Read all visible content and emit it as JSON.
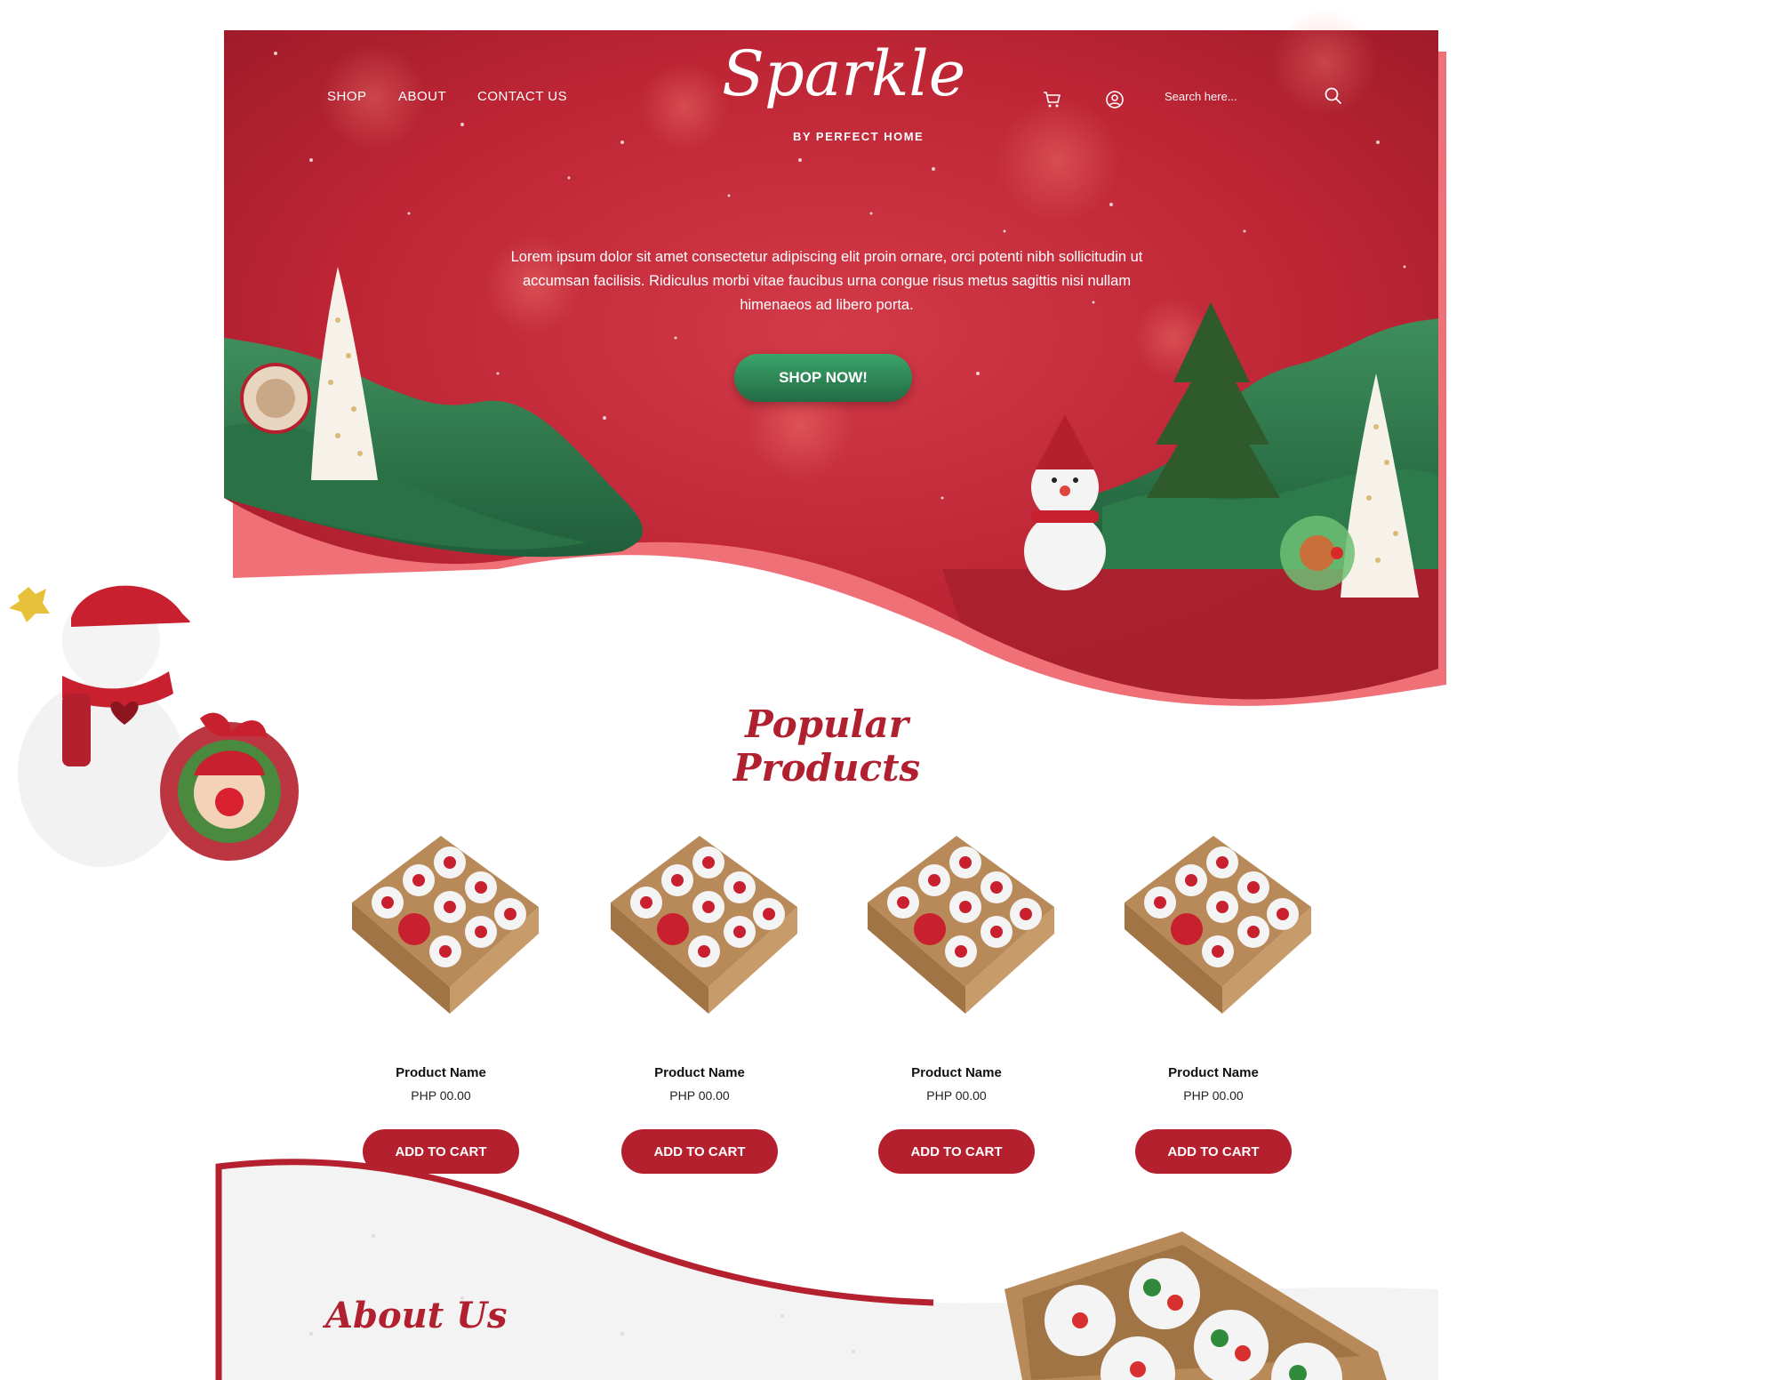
{
  "nav": {
    "shop": "SHOP",
    "about": "ABOUT",
    "contact": "CONTACT US"
  },
  "logo": {
    "main": "Sparkle",
    "sub": "BY PERFECT HOME"
  },
  "header": {
    "cart_icon": "cart-icon",
    "account_icon": "user-circle-icon",
    "search_icon": "search-icon",
    "search_placeholder": "Search here..."
  },
  "hero": {
    "text": "Lorem ipsum dolor sit amet consectetur adipiscing elit proin ornare, orci potenti nibh sollicitudin ut accumsan facilisis. Ridiculus morbi vitae faucibus urna congue risus metus sagittis nisi nullam himenaeos ad libero porta.",
    "cta": "SHOP NOW!"
  },
  "popular": {
    "title": "Popular Products",
    "products": [
      {
        "name": "Product Name",
        "price": "PHP 00.00",
        "button": "ADD TO CART"
      },
      {
        "name": "Product Name",
        "price": "PHP 00.00",
        "button": "ADD TO CART"
      },
      {
        "name": "Product Name",
        "price": "PHP 00.00",
        "button": "ADD TO CART"
      },
      {
        "name": "Product Name",
        "price": "PHP 00.00",
        "button": "ADD TO CART"
      }
    ]
  },
  "about": {
    "title": "About Us"
  },
  "colors": {
    "primary_red": "#b5202e",
    "hero_red": "#c0283a",
    "accent_green": "#2f7a4c",
    "pink_edge": "#f06b74"
  }
}
